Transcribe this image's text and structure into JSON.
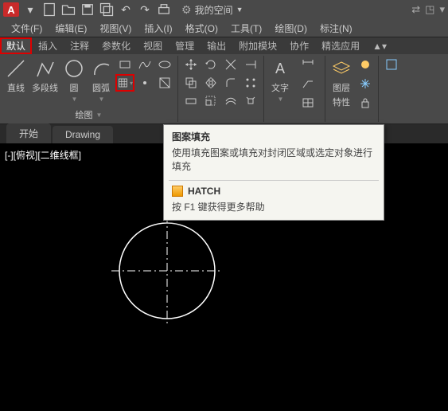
{
  "app": {
    "logo": "A"
  },
  "workspace": {
    "label": "我的空间"
  },
  "menus": {
    "file": "文件(F)",
    "edit": "编辑(E)",
    "view": "视图(V)",
    "insert": "插入(I)",
    "format": "格式(O)",
    "tools": "工具(T)",
    "draw": "绘图(D)",
    "dim": "标注(N)"
  },
  "rtabs": {
    "default": "默认",
    "insert": "插入",
    "annotate": "注释",
    "param": "参数化",
    "view": "视图",
    "manage": "管理",
    "output": "输出",
    "addons": "附加模块",
    "collab": "协作",
    "featured": "精选应用"
  },
  "tools": {
    "line": "直线",
    "pline": "多段线",
    "circle": "圆",
    "arc": "圆弧",
    "text": "文字",
    "layer": "图层",
    "layerprop": "特性"
  },
  "panel": {
    "draw": "绘图"
  },
  "doctabs": {
    "start": "开始",
    "drawing": "Drawing"
  },
  "viewport": {
    "label": "[-][俯视][二维线框]"
  },
  "tooltip": {
    "title": "图案填充",
    "desc": "使用填充图案或填充对封闭区域或选定对象进行填充",
    "cmd": "HATCH",
    "help": "按 F1 键获得更多帮助"
  }
}
